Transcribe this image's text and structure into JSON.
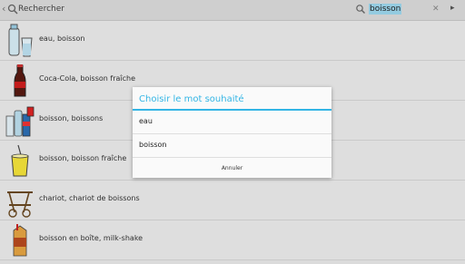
{
  "topbar": {
    "back_icon": "chevron-left-icon",
    "app_icon": "search-icon",
    "title": "Rechercher"
  },
  "search": {
    "value": "boisson",
    "clear_icon": "close-icon",
    "go_icon": "arrow-right-icon"
  },
  "results": [
    {
      "label": "eau, boisson",
      "icon": "water-bottle-and-glass"
    },
    {
      "label": "Coca-Cola, boisson fraîche",
      "icon": "cola-bottle"
    },
    {
      "label": "boisson, boissons",
      "icon": "assorted-drinks"
    },
    {
      "label": "boisson, boisson fraîche",
      "icon": "glass-with-straw"
    },
    {
      "label": "chariot, chariot de boissons",
      "icon": "drinks-trolley"
    },
    {
      "label": "boisson en boîte, milk-shake",
      "icon": "drink-carton"
    }
  ],
  "dialog": {
    "title": "Choisir le mot souhaité",
    "options": [
      "eau",
      "boisson"
    ],
    "cancel_label": "Annuler"
  },
  "colors": {
    "accent": "#33b5e5",
    "background": "#ececec"
  }
}
